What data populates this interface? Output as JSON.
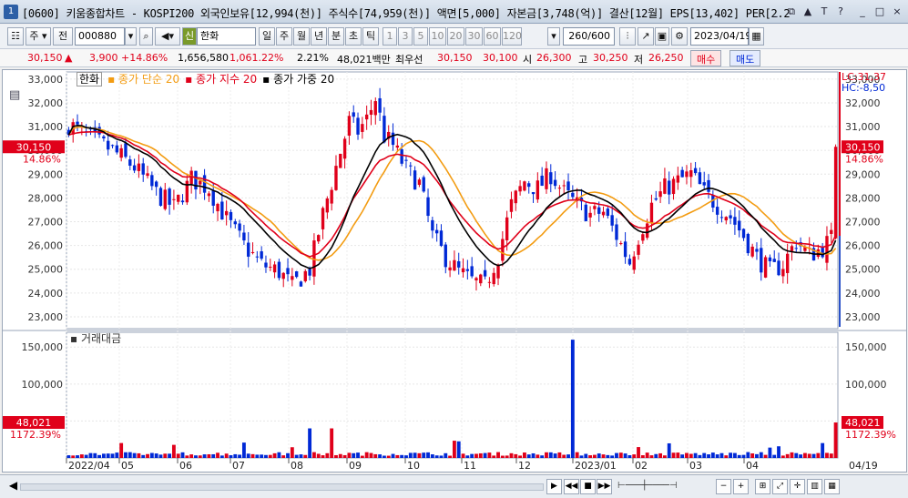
{
  "window": {
    "badge": "1",
    "title": "[0600] 키움종합차트 - KOSPI200 외국인보유[12,994(천)] 주식수[74,959(천)] 액면[5,000] 자본금[3,748(억)] 결산[12월] EPS[13,402] PER[2.2"
  },
  "window_controls": [
    "_",
    "⧉",
    "▲",
    "T",
    "?",
    "_",
    "□",
    "×"
  ],
  "toolbar": {
    "market": "주",
    "prev": "전",
    "code": "000880",
    "name_badge": "신",
    "name": "한화",
    "periods": [
      "일",
      "주",
      "월",
      "년",
      "분",
      "초",
      "틱"
    ],
    "active_period": "일",
    "minutes": [
      "1",
      "3",
      "5",
      "10",
      "20",
      "30",
      "60",
      "120"
    ],
    "count": "260/600",
    "date": "2023/04/19"
  },
  "quote": {
    "price": "30,150",
    "arrow": "▲",
    "change": "3,900",
    "change_pct": "+14.86%",
    "volume": "1,656,580",
    "vol_ratio": "1,061.22%",
    "turnover": "2.21%",
    "amount": "48,021백만",
    "pref_label": "최우선",
    "ask": "30,150",
    "bid": "30,100",
    "open_label": "시",
    "open": "26,300",
    "high_label": "고",
    "high": "30,250",
    "low_label": "저",
    "low": "26,250",
    "buy": "매수",
    "sell": "매도"
  },
  "legend": [
    {
      "label": "한화",
      "color": "#000000"
    },
    {
      "label": "종가 단순 20",
      "color": "#f39c12"
    },
    {
      "label": "종가 지수 20",
      "color": "#e0001a"
    },
    {
      "label": "종가 가중 20",
      "color": "#000000"
    }
  ],
  "lower_title": "거래대금",
  "right_info": {
    "lc": "LC:31,37",
    "hc": "HC:-8,50"
  },
  "price_tag": {
    "value": "30,150",
    "pct": "14.86%"
  },
  "volume_tag": {
    "value": "48,021",
    "pct": "1172.39%"
  },
  "colors": {
    "up": "#e0001a",
    "down": "#0029d6",
    "sma": "#f39c12",
    "ema": "#e0001a",
    "wma": "#000000"
  },
  "chart_data": {
    "type": "candlestick",
    "price_axis": {
      "min": 22500,
      "max": 33300,
      "ticks": [
        "33,000",
        "32,000",
        "31,000",
        "30,000",
        "29,000",
        "28,000",
        "27,000",
        "26,000",
        "25,000",
        "24,000",
        "23,000"
      ]
    },
    "volume_axis": {
      "min": 0,
      "max": 170000,
      "ticks": [
        "150,000",
        "100,000",
        "50,000"
      ]
    },
    "x_labels": [
      "2022/04",
      "05",
      "06",
      "07",
      "08",
      "09",
      "10",
      "11",
      "12",
      "2023/01",
      "02",
      "03",
      "04"
    ],
    "x_last_label": "04/19",
    "anchors": [
      [
        0,
        31100
      ],
      [
        5,
        30500
      ],
      [
        10,
        30000
      ],
      [
        15,
        29300
      ],
      [
        20,
        28200
      ],
      [
        24,
        27600
      ],
      [
        28,
        28800
      ],
      [
        32,
        28400
      ],
      [
        36,
        27100
      ],
      [
        40,
        26000
      ],
      [
        44,
        25200
      ],
      [
        48,
        24900
      ],
      [
        51,
        24300
      ],
      [
        55,
        25000
      ],
      [
        58,
        27300
      ],
      [
        61,
        29300
      ],
      [
        64,
        31200
      ],
      [
        66,
        30800
      ],
      [
        68,
        31300
      ],
      [
        70,
        32200
      ],
      [
        72,
        30600
      ],
      [
        74,
        30200
      ],
      [
        77,
        29200
      ],
      [
        80,
        28600
      ],
      [
        83,
        26400
      ],
      [
        86,
        25500
      ],
      [
        89,
        24900
      ],
      [
        92,
        24500
      ],
      [
        95,
        24300
      ],
      [
        98,
        25600
      ],
      [
        101,
        27700
      ],
      [
        104,
        28700
      ],
      [
        107,
        28400
      ],
      [
        110,
        29000
      ],
      [
        113,
        28200
      ],
      [
        116,
        27700
      ],
      [
        119,
        27300
      ],
      [
        122,
        27400
      ],
      [
        125,
        26400
      ],
      [
        128,
        25300
      ],
      [
        130,
        26400
      ],
      [
        133,
        27700
      ],
      [
        136,
        28400
      ],
      [
        139,
        28700
      ],
      [
        142,
        29000
      ],
      [
        145,
        28200
      ],
      [
        148,
        27700
      ],
      [
        151,
        27200
      ],
      [
        154,
        26400
      ],
      [
        157,
        25500
      ],
      [
        160,
        24900
      ],
      [
        163,
        25200
      ],
      [
        166,
        26200
      ],
      [
        169,
        25600
      ],
      [
        172,
        25900
      ],
      [
        174,
        26300
      ],
      [
        175,
        30150
      ]
    ],
    "last_bar": {
      "open": 26300,
      "high": 30250,
      "low": 26250,
      "close": 30150,
      "amount": 48021
    },
    "volume_spike": {
      "index": 115,
      "amount": 160000
    }
  }
}
